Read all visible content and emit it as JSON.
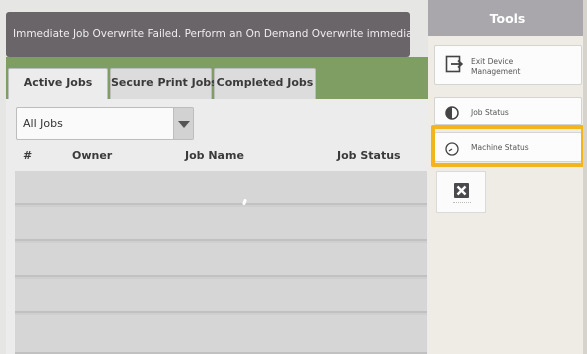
{
  "banner": {
    "message": "Immediate Job Overwrite Failed.  Perform an On Demand Overwrite immediately."
  },
  "tabs": [
    {
      "label": "Active Jobs",
      "active": true
    },
    {
      "label": "Secure Print Jobs",
      "active": false
    },
    {
      "label": "Completed Jobs",
      "active": false
    }
  ],
  "filter": {
    "selected": "All Jobs"
  },
  "table": {
    "columns": [
      "#",
      "Owner",
      "Job Name",
      "Job Status"
    ],
    "rows": []
  },
  "tools": {
    "title": "Tools",
    "items": [
      {
        "label": "Exit Device Management",
        "icon": "exit-icon"
      },
      {
        "label": "Job Status",
        "icon": "job-status-icon"
      },
      {
        "label": "Machine Status",
        "icon": "machine-status-icon",
        "highlighted": true
      }
    ],
    "close_icon": "close-icon"
  },
  "colors": {
    "banner": "#6a6569",
    "accent_green": "#7e9e63",
    "tools_header": "#a9a7ab",
    "highlight": "#f2b51c"
  }
}
